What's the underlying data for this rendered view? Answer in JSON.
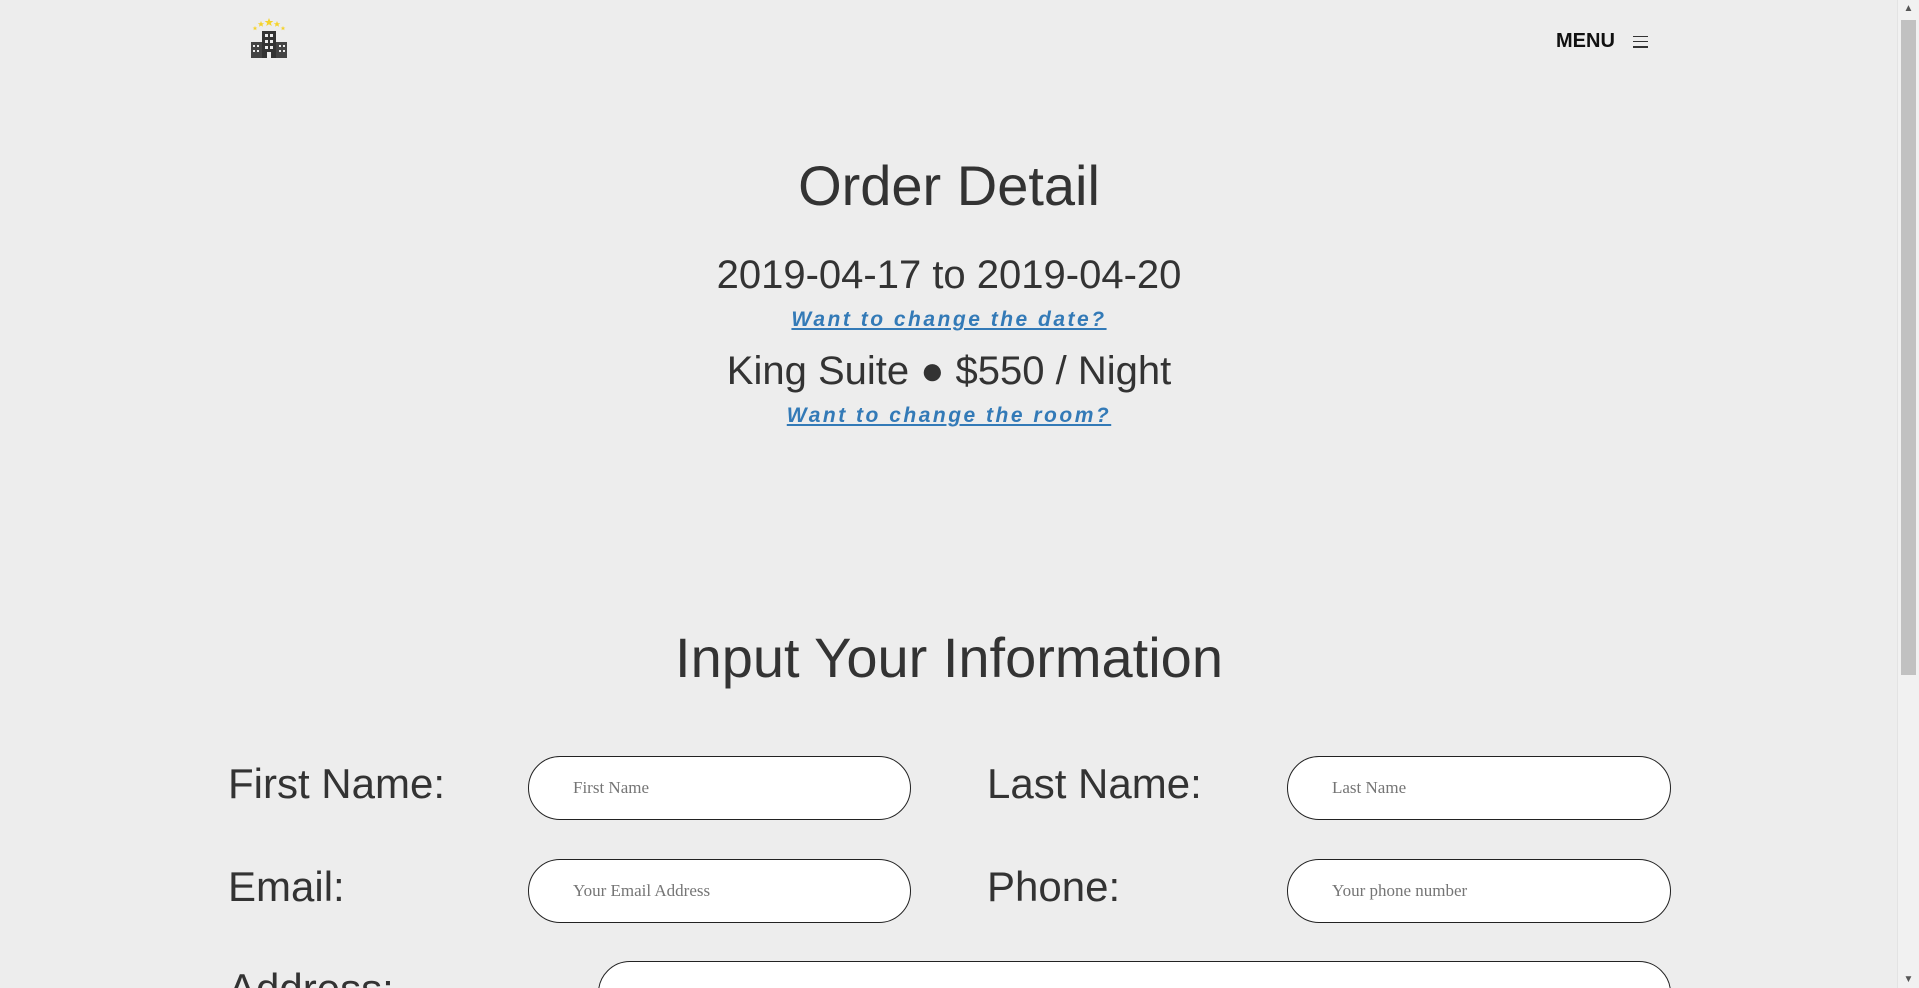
{
  "header": {
    "logo_icon": "hotel-building-icon",
    "menu_label": "MENU",
    "menu_icon": "hamburger-icon"
  },
  "order": {
    "title": "Order Detail",
    "date_range": "2019-04-17 to 2019-04-20",
    "change_date_link": "Want to change the date?",
    "room": "King Suite ● $550 / Night",
    "change_room_link": "Want to change the room?"
  },
  "form": {
    "title": "Input Your Information",
    "first_name_label": "First Name:",
    "first_name_placeholder": "First Name",
    "last_name_label": "Last Name:",
    "last_name_placeholder": "Last Name",
    "email_label": "Email:",
    "email_placeholder": "Your Email Address",
    "phone_label": "Phone:",
    "phone_placeholder": "Your phone number",
    "address_label": "Address:"
  },
  "colors": {
    "background": "#ededed",
    "link": "#337ab7",
    "text": "#333333",
    "logo_star": "#f5d32c"
  }
}
